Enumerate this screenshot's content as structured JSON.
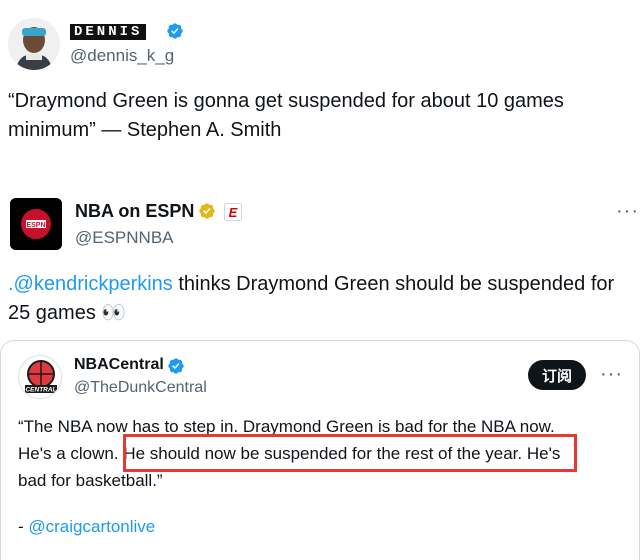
{
  "tweet1": {
    "display_name": "DENNIS",
    "handle": "@dennis_k_g",
    "text": "“Draymond Green is gonna get suspended for about 10 games minimum” — Stephen A. Smith"
  },
  "tweet2": {
    "display_name": "NBA on ESPN",
    "handle": "@ESPNNBA",
    "mention": ".@kendrickperkins",
    "text_after": " thinks Draymond Green should be suspended for 25 games 👀",
    "more": "···"
  },
  "quoted": {
    "display_name": "NBACentral",
    "handle": "@TheDunkCentral",
    "subscribe": "订阅",
    "more": "···",
    "line1": "“The NBA now has to step in. Draymond Green is bad for the NBA now.",
    "line2_prefix": "He's a clown.",
    "line2_highlight": "He should now be suspended for the rest of the year.",
    "line2_suffix": "He's",
    "line3": "bad for basketball.”",
    "credit_prefix": "- ",
    "credit_link": "@craigcartonlive"
  },
  "colors": {
    "verified_blue": "#1d9bf0",
    "verified_gold": "#e2b719",
    "highlight_red": "#e53935",
    "espn_red": "#d00"
  }
}
